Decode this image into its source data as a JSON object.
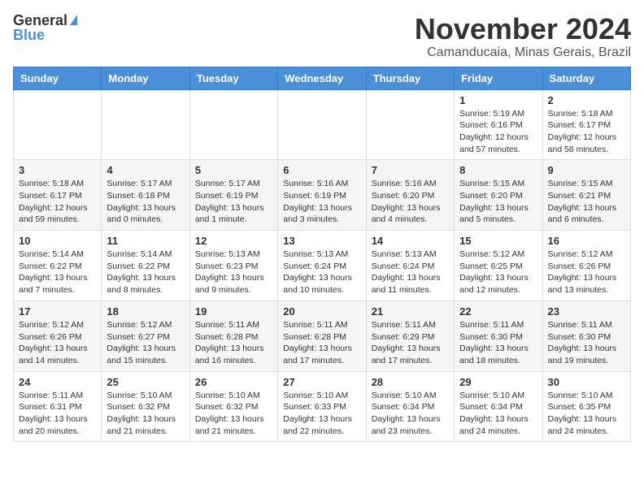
{
  "header": {
    "logo_general": "General",
    "logo_blue": "Blue",
    "month": "November 2024",
    "location": "Camanducaia, Minas Gerais, Brazil"
  },
  "weekdays": [
    "Sunday",
    "Monday",
    "Tuesday",
    "Wednesday",
    "Thursday",
    "Friday",
    "Saturday"
  ],
  "weeks": [
    [
      {
        "day": "",
        "info": ""
      },
      {
        "day": "",
        "info": ""
      },
      {
        "day": "",
        "info": ""
      },
      {
        "day": "",
        "info": ""
      },
      {
        "day": "",
        "info": ""
      },
      {
        "day": "1",
        "info": "Sunrise: 5:19 AM\nSunset: 6:16 PM\nDaylight: 12 hours\nand 57 minutes."
      },
      {
        "day": "2",
        "info": "Sunrise: 5:18 AM\nSunset: 6:17 PM\nDaylight: 12 hours\nand 58 minutes."
      }
    ],
    [
      {
        "day": "3",
        "info": "Sunrise: 5:18 AM\nSunset: 6:17 PM\nDaylight: 12 hours\nand 59 minutes."
      },
      {
        "day": "4",
        "info": "Sunrise: 5:17 AM\nSunset: 6:18 PM\nDaylight: 13 hours\nand 0 minutes."
      },
      {
        "day": "5",
        "info": "Sunrise: 5:17 AM\nSunset: 6:19 PM\nDaylight: 13 hours\nand 1 minute."
      },
      {
        "day": "6",
        "info": "Sunrise: 5:16 AM\nSunset: 6:19 PM\nDaylight: 13 hours\nand 3 minutes."
      },
      {
        "day": "7",
        "info": "Sunrise: 5:16 AM\nSunset: 6:20 PM\nDaylight: 13 hours\nand 4 minutes."
      },
      {
        "day": "8",
        "info": "Sunrise: 5:15 AM\nSunset: 6:20 PM\nDaylight: 13 hours\nand 5 minutes."
      },
      {
        "day": "9",
        "info": "Sunrise: 5:15 AM\nSunset: 6:21 PM\nDaylight: 13 hours\nand 6 minutes."
      }
    ],
    [
      {
        "day": "10",
        "info": "Sunrise: 5:14 AM\nSunset: 6:22 PM\nDaylight: 13 hours\nand 7 minutes."
      },
      {
        "day": "11",
        "info": "Sunrise: 5:14 AM\nSunset: 6:22 PM\nDaylight: 13 hours\nand 8 minutes."
      },
      {
        "day": "12",
        "info": "Sunrise: 5:13 AM\nSunset: 6:23 PM\nDaylight: 13 hours\nand 9 minutes."
      },
      {
        "day": "13",
        "info": "Sunrise: 5:13 AM\nSunset: 6:24 PM\nDaylight: 13 hours\nand 10 minutes."
      },
      {
        "day": "14",
        "info": "Sunrise: 5:13 AM\nSunset: 6:24 PM\nDaylight: 13 hours\nand 11 minutes."
      },
      {
        "day": "15",
        "info": "Sunrise: 5:12 AM\nSunset: 6:25 PM\nDaylight: 13 hours\nand 12 minutes."
      },
      {
        "day": "16",
        "info": "Sunrise: 5:12 AM\nSunset: 6:26 PM\nDaylight: 13 hours\nand 13 minutes."
      }
    ],
    [
      {
        "day": "17",
        "info": "Sunrise: 5:12 AM\nSunset: 6:26 PM\nDaylight: 13 hours\nand 14 minutes."
      },
      {
        "day": "18",
        "info": "Sunrise: 5:12 AM\nSunset: 6:27 PM\nDaylight: 13 hours\nand 15 minutes."
      },
      {
        "day": "19",
        "info": "Sunrise: 5:11 AM\nSunset: 6:28 PM\nDaylight: 13 hours\nand 16 minutes."
      },
      {
        "day": "20",
        "info": "Sunrise: 5:11 AM\nSunset: 6:28 PM\nDaylight: 13 hours\nand 17 minutes."
      },
      {
        "day": "21",
        "info": "Sunrise: 5:11 AM\nSunset: 6:29 PM\nDaylight: 13 hours\nand 17 minutes."
      },
      {
        "day": "22",
        "info": "Sunrise: 5:11 AM\nSunset: 6:30 PM\nDaylight: 13 hours\nand 18 minutes."
      },
      {
        "day": "23",
        "info": "Sunrise: 5:11 AM\nSunset: 6:30 PM\nDaylight: 13 hours\nand 19 minutes."
      }
    ],
    [
      {
        "day": "24",
        "info": "Sunrise: 5:11 AM\nSunset: 6:31 PM\nDaylight: 13 hours\nand 20 minutes."
      },
      {
        "day": "25",
        "info": "Sunrise: 5:10 AM\nSunset: 6:32 PM\nDaylight: 13 hours\nand 21 minutes."
      },
      {
        "day": "26",
        "info": "Sunrise: 5:10 AM\nSunset: 6:32 PM\nDaylight: 13 hours\nand 21 minutes."
      },
      {
        "day": "27",
        "info": "Sunrise: 5:10 AM\nSunset: 6:33 PM\nDaylight: 13 hours\nand 22 minutes."
      },
      {
        "day": "28",
        "info": "Sunrise: 5:10 AM\nSunset: 6:34 PM\nDaylight: 13 hours\nand 23 minutes."
      },
      {
        "day": "29",
        "info": "Sunrise: 5:10 AM\nSunset: 6:34 PM\nDaylight: 13 hours\nand 24 minutes."
      },
      {
        "day": "30",
        "info": "Sunrise: 5:10 AM\nSunset: 6:35 PM\nDaylight: 13 hours\nand 24 minutes."
      }
    ]
  ]
}
